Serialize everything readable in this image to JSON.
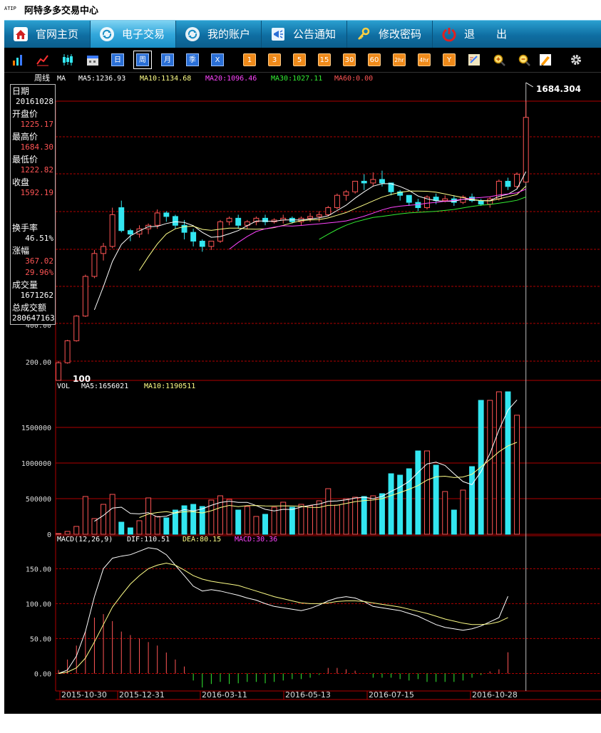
{
  "window": {
    "logo": "ATIP",
    "title": "阿特多多交易中心"
  },
  "nav": {
    "tabs": [
      {
        "label": "官网主页",
        "icon": "home-icon",
        "active": false
      },
      {
        "label": "电子交易",
        "icon": "exchange-icon",
        "active": true
      },
      {
        "label": "我的账户",
        "icon": "account-icon",
        "active": false
      },
      {
        "label": "公告通知",
        "icon": "notice-icon",
        "active": false
      },
      {
        "label": "修改密码",
        "icon": "key-icon",
        "active": false
      },
      {
        "label": "退　　出",
        "icon": "power-icon",
        "active": false
      }
    ]
  },
  "toolbar": {
    "icon_buttons": [
      "bar-chart-icon",
      "line-chart-icon",
      "candlestick-icon",
      "calendar-icon"
    ],
    "period_buttons": [
      "日",
      "周",
      "月",
      "季",
      "X"
    ],
    "selected_period": "周",
    "minute_buttons": [
      "1",
      "3",
      "5",
      "15",
      "30",
      "60",
      "2hr",
      "4hr",
      "Y"
    ],
    "tool_buttons": [
      "draw-icon",
      "zoom-in-icon",
      "zoom-out-icon",
      "pencil-icon",
      "gear-icon"
    ]
  },
  "colors": {
    "up": "#ff5555",
    "down": "#33e6f0",
    "ma5": "#ffffff",
    "ma10": "#ffff88",
    "ma20": "#ff44ff",
    "ma30": "#33ee33",
    "grid": "#b00000",
    "bg": "#000000"
  },
  "info": {
    "date_label": "日期",
    "date": "20161028",
    "open_label": "开盘价",
    "open": "1225.17",
    "high_label": "最高价",
    "high": "1684.30",
    "low_label": "最低价",
    "low": "1222.82",
    "close_label": "收盘",
    "close": "1592.19",
    "turnover_label": "换手率",
    "turnover": "46.51%",
    "change_label": "涨幅",
    "change": "367.02",
    "change_pct": "29.96%",
    "volume_label": "成交量",
    "volume": "1671262",
    "amount_label": "总成交额",
    "amount": "280647163"
  },
  "price_panel": {
    "period_label": "周线",
    "ma_label": "MA",
    "ma5": "MA5:1236.93",
    "ma10": "MA10:1134.68",
    "ma20": "MA20:1096.46",
    "ma30": "MA30:1027.11",
    "ma60": "MA60:0.00",
    "high_marker": "1684.304",
    "low_marker": "100",
    "yticks": [
      "200.00",
      "400.00"
    ]
  },
  "volume_panel": {
    "label": "VOL",
    "ma5": "MA5:1656021",
    "ma10": "MA10:1190511",
    "yticks": [
      "0",
      "500000",
      "1000000",
      "1500000"
    ]
  },
  "macd_panel": {
    "label": "MACD(12,26,9)",
    "dif": "DIF:110.51",
    "dea": "DEA:80.15",
    "macd": "MACD:30.36",
    "yticks": [
      "0.00",
      "50.00",
      "100.00",
      "150.00"
    ]
  },
  "xaxis": {
    "labels": [
      "2015-10-30",
      "2015-12-31",
      "2016-03-11",
      "2016-05-13",
      "2016-07-15",
      "2016-10-28"
    ]
  },
  "chart_data": {
    "type": "candlestick",
    "title": "周线",
    "ylim_price": [
      100,
      1684.304
    ],
    "ylim_volume": [
      0,
      2000000
    ],
    "ylim_macd": [
      -25,
      185
    ],
    "ohlc": [
      [
        100,
        210,
        100,
        200
      ],
      [
        200,
        330,
        195,
        325
      ],
      [
        325,
        470,
        320,
        465
      ],
      [
        465,
        700,
        460,
        690
      ],
      [
        690,
        840,
        680,
        820
      ],
      [
        820,
        880,
        780,
        860
      ],
      [
        860,
        1080,
        850,
        1040
      ],
      [
        1080,
        1120,
        940,
        950
      ],
      [
        950,
        960,
        890,
        930
      ],
      [
        930,
        980,
        910,
        960
      ],
      [
        960,
        990,
        930,
        980
      ],
      [
        980,
        1070,
        960,
        1050
      ],
      [
        1050,
        1060,
        1000,
        1030
      ],
      [
        1030,
        1040,
        960,
        980
      ],
      [
        980,
        1010,
        900,
        940
      ],
      [
        940,
        960,
        860,
        890
      ],
      [
        890,
        900,
        830,
        860
      ],
      [
        860,
        890,
        840,
        890
      ],
      [
        890,
        1010,
        880,
        1000
      ],
      [
        1000,
        1030,
        980,
        1020
      ],
      [
        1020,
        1040,
        960,
        980
      ],
      [
        980,
        1010,
        960,
        1000
      ],
      [
        1000,
        1030,
        980,
        1020
      ],
      [
        1020,
        1040,
        980,
        1000
      ],
      [
        1000,
        1020,
        990,
        1010
      ],
      [
        1010,
        1040,
        990,
        1020
      ],
      [
        1020,
        1030,
        990,
        1000
      ],
      [
        1000,
        1030,
        980,
        1020
      ],
      [
        1020,
        1050,
        1000,
        1030
      ],
      [
        1030,
        1060,
        1000,
        1040
      ],
      [
        1040,
        1090,
        1030,
        1080
      ],
      [
        1080,
        1160,
        1070,
        1150
      ],
      [
        1150,
        1180,
        1120,
        1170
      ],
      [
        1170,
        1230,
        1160,
        1230
      ],
      [
        1230,
        1270,
        1180,
        1220
      ],
      [
        1220,
        1280,
        1200,
        1240
      ],
      [
        1240,
        1290,
        1200,
        1220
      ],
      [
        1220,
        1200,
        1150,
        1170
      ],
      [
        1170,
        1180,
        1120,
        1150
      ],
      [
        1150,
        1150,
        1090,
        1110
      ],
      [
        1110,
        1130,
        1060,
        1080
      ],
      [
        1080,
        1150,
        1070,
        1140
      ],
      [
        1140,
        1160,
        1100,
        1120
      ],
      [
        1120,
        1150,
        1110,
        1130
      ],
      [
        1130,
        1150,
        1090,
        1110
      ],
      [
        1110,
        1150,
        1100,
        1140
      ],
      [
        1140,
        1160,
        1110,
        1120
      ],
      [
        1120,
        1130,
        1090,
        1100
      ],
      [
        1100,
        1140,
        1080,
        1130
      ],
      [
        1130,
        1240,
        1120,
        1230
      ],
      [
        1230,
        1250,
        1180,
        1200
      ],
      [
        1200,
        1280,
        1190,
        1270
      ],
      [
        1225.17,
        1684.3,
        1222.82,
        1592.19
      ]
    ],
    "volume": [
      10000,
      40000,
      110000,
      530000,
      220000,
      420000,
      560000,
      170000,
      90000,
      190000,
      510000,
      250000,
      230000,
      340000,
      400000,
      420000,
      390000,
      480000,
      540000,
      490000,
      340000,
      390000,
      250000,
      280000,
      380000,
      450000,
      380000,
      420000,
      400000,
      470000,
      640000,
      410000,
      500000,
      520000,
      530000,
      540000,
      570000,
      850000,
      830000,
      920000,
      1170000,
      1170000,
      970000,
      600000,
      340000,
      620000,
      950000,
      1880000,
      1880000,
      2000000,
      2000000,
      1671262
    ],
    "macd": {
      "dif": [
        0,
        5,
        25,
        60,
        110,
        150,
        165,
        168,
        170,
        175,
        180,
        178,
        170,
        155,
        140,
        125,
        118,
        120,
        118,
        115,
        112,
        108,
        105,
        100,
        96,
        94,
        92,
        90,
        93,
        98,
        104,
        108,
        110,
        108,
        103,
        96,
        94,
        92,
        90,
        86,
        82,
        76,
        70,
        66,
        64,
        62,
        64,
        68,
        74,
        80,
        110.51
      ],
      "dea": [
        0,
        2,
        8,
        22,
        45,
        70,
        95,
        112,
        128,
        140,
        150,
        155,
        158,
        155,
        148,
        140,
        135,
        132,
        130,
        128,
        126,
        122,
        118,
        114,
        110,
        107,
        104,
        101,
        100,
        100,
        101,
        103,
        104,
        104,
        103,
        101,
        99,
        97,
        95,
        92,
        89,
        86,
        82,
        78,
        75,
        72,
        70,
        70,
        71,
        74,
        80.15
      ],
      "hist": [
        5,
        20,
        40,
        60,
        80,
        85,
        75,
        60,
        55,
        50,
        45,
        40,
        30,
        20,
        10,
        -10,
        -20,
        -15,
        -12,
        -15,
        -14,
        -12,
        -12,
        -14,
        -12,
        -10,
        -8,
        -8,
        -6,
        -2,
        8,
        8,
        6,
        4,
        0,
        -6,
        -6,
        -6,
        -8,
        -10,
        -8,
        -12,
        -12,
        -12,
        -12,
        -10,
        -6,
        -2,
        3,
        6,
        30.36
      ]
    }
  }
}
